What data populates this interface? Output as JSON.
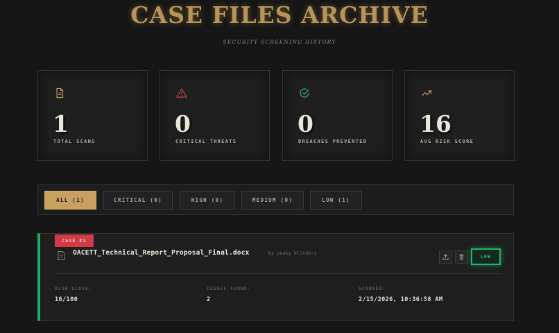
{
  "header": {
    "title": "CASE FILES ARCHIVE",
    "subtitle": "SECURITY SCREENING HISTORY"
  },
  "stats": [
    {
      "value": "1",
      "label": "TOTAL SCANS",
      "icon": "document-icon",
      "color": "#b8935a"
    },
    {
      "value": "0",
      "label": "CRITICAL THREATS",
      "icon": "warning-triangle-icon",
      "color": "#c0454a"
    },
    {
      "value": "0",
      "label": "BREACHES PREVENTED",
      "icon": "check-circle-icon",
      "color": "#2fa88a"
    },
    {
      "value": "16",
      "label": "AVG RISK SCORE",
      "icon": "trending-up-icon",
      "color": "#b8935a"
    }
  ],
  "filters": [
    {
      "label": "ALL (1)",
      "active": true
    },
    {
      "label": "CRITICAL (0)",
      "active": false
    },
    {
      "label": "HIGH (0)",
      "active": false
    },
    {
      "label": "MEDIUM (0)",
      "active": false
    },
    {
      "label": "LOW (1)",
      "active": false
    }
  ],
  "case": {
    "tag": "CASE #1",
    "filename": "OACETT_Technical_Report_Proposal_Final.docx",
    "author": "by peaky blinders",
    "risk_level": "LOW",
    "accent_color": "#1fae62",
    "risk_score_label": "RISK SCORE:",
    "risk_score_value": "16/100",
    "issues_label": "ISSUES FOUND:",
    "issues_value": "2",
    "scanned_label": "SCANNED:",
    "scanned_value": "2/15/2026, 10:36:58 AM"
  }
}
